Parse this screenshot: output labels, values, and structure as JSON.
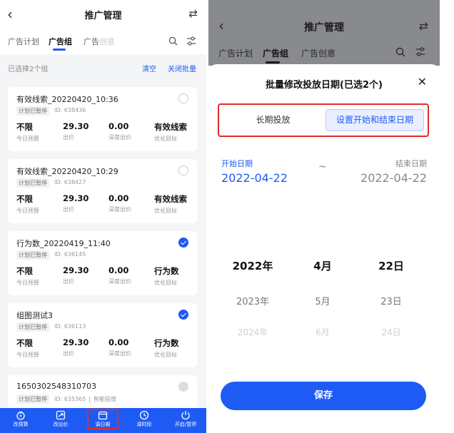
{
  "left": {
    "header": {
      "title": "推广管理"
    },
    "tabs": [
      {
        "label": "广告计划"
      },
      {
        "label": "广告组"
      },
      {
        "label": "广告创意"
      }
    ],
    "selection": {
      "text": "已选择2个组",
      "clear": "清空",
      "close_batch": "关闭批量"
    },
    "cards": [
      {
        "name": "有效线索_20220420_10:36",
        "tag": "计划已暂停",
        "id": "ID: 638436",
        "checked": false,
        "metrics": [
          {
            "v": "不限",
            "k": "今日预算"
          },
          {
            "v": "29.30",
            "k": "出价"
          },
          {
            "v": "0.00",
            "k": "深度出价"
          },
          {
            "v": "有效线索",
            "k": "优化目标"
          }
        ]
      },
      {
        "name": "有效线索_20220420_10:29",
        "tag": "计划已暂停",
        "id": "ID: 638427",
        "checked": false,
        "metrics": [
          {
            "v": "不限",
            "k": "今日预算"
          },
          {
            "v": "29.30",
            "k": "出价"
          },
          {
            "v": "0.00",
            "k": "深度出价"
          },
          {
            "v": "有效线索",
            "k": "优化目标"
          }
        ]
      },
      {
        "name": "行为数_20220419_11:40",
        "tag": "计划已暂停",
        "id": "ID: 636145",
        "checked": true,
        "metrics": [
          {
            "v": "不限",
            "k": "今日预算"
          },
          {
            "v": "29.30",
            "k": "出价"
          },
          {
            "v": "0.00",
            "k": "深度出价"
          },
          {
            "v": "行为数",
            "k": "优化目标"
          }
        ]
      },
      {
        "name": "组图测试3",
        "tag": "计划已暂停",
        "id": "ID: 636113",
        "checked": true,
        "metrics": [
          {
            "v": "不限",
            "k": "今日预算"
          },
          {
            "v": "29.30",
            "k": "出价"
          },
          {
            "v": "0.00",
            "k": "深度出价"
          },
          {
            "v": "行为数",
            "k": "优化目标"
          }
        ]
      },
      {
        "name": "1650302548310703",
        "tag": "计划已暂停",
        "id": "ID: 635365",
        "extra": "智能投放",
        "checked": false
      }
    ],
    "bottom_bar": [
      {
        "label": "改预算",
        "icon": "budget-icon"
      },
      {
        "label": "改出价",
        "icon": "bid-icon"
      },
      {
        "label": "调日期",
        "icon": "calendar-icon"
      },
      {
        "label": "调时段",
        "icon": "clock-icon"
      },
      {
        "label": "开启/暂停",
        "icon": "power-icon"
      }
    ]
  },
  "right": {
    "header": {
      "title": "推广管理"
    },
    "tabs": [
      {
        "label": "广告计划"
      },
      {
        "label": "广告组"
      },
      {
        "label": "广告创意"
      }
    ],
    "sheet": {
      "title": "批量修改投放日期(已选2个)",
      "options": {
        "long_term": "长期投放",
        "range": "设置开始和结束日期"
      },
      "start_label": "开始日期",
      "start_value": "2022-04-22",
      "separator": "~",
      "end_label": "结束日期",
      "end_value": "2022-04-22",
      "picker": {
        "years": [
          "2022年",
          "2023年",
          "2024年"
        ],
        "months": [
          "4月",
          "5月",
          "6月"
        ],
        "days": [
          "22日",
          "23日",
          "24日"
        ]
      },
      "save_label": "保存"
    }
  },
  "colors": {
    "primary": "#1e5bf5",
    "highlight_box": "#e22b2b"
  }
}
